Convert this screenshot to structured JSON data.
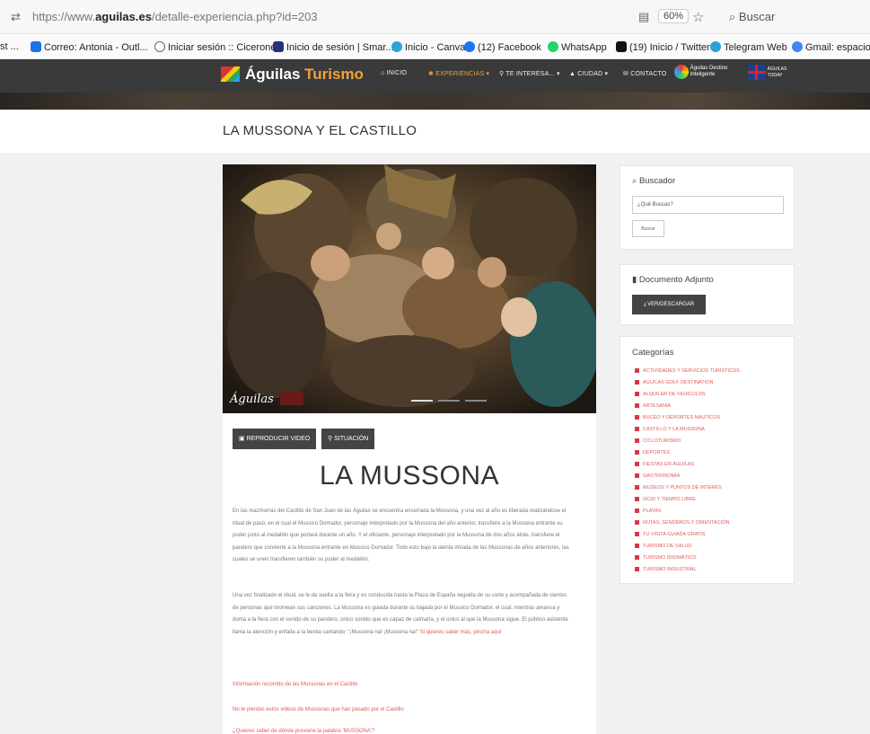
{
  "browser": {
    "url_prefix": "https://www.",
    "url_domain": "aguilas.es",
    "url_path": "/detalle-experiencia.php?id=203",
    "zoom": "60%",
    "search_placeholder": "Buscar",
    "bookmarks": [
      {
        "label": "st ...",
        "icon": "",
        "color": ""
      },
      {
        "label": "Correo: Antonia - Outl...",
        "icon": "outlook-icon",
        "color": "#1a73e8"
      },
      {
        "label": "Iniciar sesión :: Cicerone",
        "icon": "globe-icon",
        "color": "#666666"
      },
      {
        "label": "Inicio de sesión | Smar...",
        "icon": "smart-icon",
        "color": "#223377"
      },
      {
        "label": "Inicio - Canva",
        "icon": "canva-icon",
        "color": "#2aa5d8"
      },
      {
        "label": "(12) Facebook",
        "icon": "facebook-icon",
        "color": "#1877f2"
      },
      {
        "label": "WhatsApp",
        "icon": "whatsapp-icon",
        "color": "#25d366"
      },
      {
        "label": "(19) Inicio / Twitter",
        "icon": "x-icon",
        "color": "#111111"
      },
      {
        "label": "Telegram Web",
        "icon": "telegram-icon",
        "color": "#2aa1da"
      },
      {
        "label": "Gmail: espacio d",
        "icon": "google-icon",
        "color": "#4285f4"
      }
    ]
  },
  "site": {
    "logo_a": "Águilas",
    "logo_b": "Turismo",
    "menu": [
      "INICIO",
      "EXPERIENCIAS",
      "TE INTERESA...",
      "CIUDAD",
      "CONTACTO"
    ],
    "badge_a": "Águilas Destino Inteligente",
    "badge_b": "ÁGUILAS TODAY",
    "page_title": "LA MUSSONA Y EL CASTILLO"
  },
  "article": {
    "hero_watermark": "Águilas",
    "btn_video": "REPRODUCIR VIDEO",
    "btn_location": "SITUACIÓN",
    "heading": "LA MUSSONA",
    "paragraph1": "En las mazmorras del Castillo de San Juan de las Águilas se encuentra encerrada la Mussona, y una vez al año es liberada realizándose el ritual de paso, en el cual el Mussico Domador, personaje interpretado por la Mussona del año anterior, transfiere a la Mussona entrante su poder junto al medallón que portará durante un año. Y el oficiante, personaje interpretado por la Mussona de dos años atrás, transfiere el pandero que convierte a la Mussona entrante en Mussico Domador. Todo esto bajo la atenta mirada de las Mussonas de años anteriores, las cuales se unen transfieren también su poder al medallón.",
    "paragraph2": "Una vez finalizado el ritual, se le da suelta a la fiera y es conducida hasta la Plaza de España seguida de su corte y acompañada de cientos de personas que bromean sus canciones. La Mussona es guiada durante su bajada por el Mussico Domador, el cual, mientras amansa y doma a la fiera con el sonido de su pandero, único sonido que es capaz de calmarla, y el único al que la Mussona sigue. El público asistente llama la atención y enfada a la bestia cantando: \"¡Mussona na! ¡Mussona na!\"",
    "paragraph2_link": "Si quieres saber más, pincha aquí",
    "links": [
      "Información recorrido de las Mussonas en el Castillo",
      "No te pierdas estos videos de Mussonas que han pasado por el Castillo",
      "¿Quieres saber de dónde proviene la palabra 'MUSSONA'?"
    ]
  },
  "sidebar": {
    "search_title": "Buscador",
    "search_placeholder": "¿Qué Buscas?",
    "search_button": "Buscar",
    "doc_title": "Documento Adjunto",
    "doc_button": "VER/DESCARGAR",
    "cat_title": "Categorías",
    "categories": [
      "Actividades y Servicios Turísticos",
      "Águilas Golf Destination",
      "Alquiler de Vehículos",
      "Artesanía",
      "Buceo y Deportes Náuticos",
      "Castillo y La Mussona",
      "Cicloturismo",
      "Deportes",
      "Fiestas en Águilas",
      "Gastronomía",
      "Museos y Puntos de Interés",
      "Ocio y Tiempo Libre",
      "Playas",
      "Rutas, Senderos y Orientación",
      "Tu Visita Guiada Gratis",
      "Turismo de Salud",
      "Turismo Idiomático",
      "Turismo Industrial"
    ]
  }
}
